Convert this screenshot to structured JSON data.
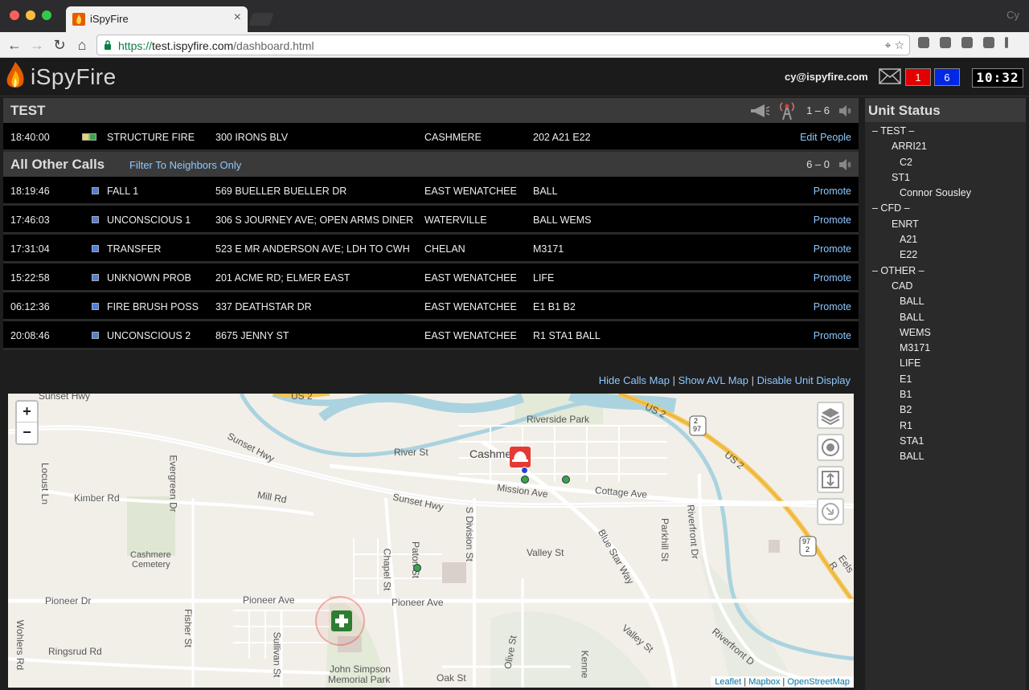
{
  "browser": {
    "tab_title": "iSpyFire",
    "tab_close": "×",
    "profile_label": "Cy",
    "url_scheme": "https://",
    "url_host": "test.ispyfire.com",
    "url_path": "/dashboard.html"
  },
  "header": {
    "app_name": "iSpyFire",
    "user_email": "cy@ispyfire.com",
    "badge_red": "1",
    "badge_blue": "6",
    "clock": "10:32",
    "badge_red_color": "#e30000",
    "badge_blue_color": "#0026e6"
  },
  "test_section": {
    "title": "TEST",
    "count": "1 – 6",
    "call": {
      "time": "18:40:00",
      "type": "STRUCTURE FIRE",
      "address": "300 IRONS BLV",
      "city": "CASHMERE",
      "units": "202 A21 E22",
      "action": "Edit People"
    }
  },
  "other_section": {
    "title": "All Other Calls",
    "filter_label": "Filter To Neighbors Only",
    "count": "6 – 0",
    "calls": [
      {
        "time": "18:19:46",
        "type": "FALL 1",
        "address": "569 BUELLER BUELLER DR",
        "city": "EAST WENATCHEE",
        "units": "BALL",
        "action": "Promote"
      },
      {
        "time": "17:46:03",
        "type": "UNCONSCIOUS 1",
        "address": "306 S JOURNEY AVE; OPEN ARMS DINER",
        "city": "WATERVILLE",
        "units": "BALL WEMS",
        "action": "Promote"
      },
      {
        "time": "17:31:04",
        "type": "TRANSFER",
        "address": "523 E MR ANDERSON AVE; LDH TO CWH",
        "city": "CHELAN",
        "units": "M3171",
        "action": "Promote"
      },
      {
        "time": "15:22:58",
        "type": "UNKNOWN PROB",
        "address": "201 ACME RD; ELMER EAST",
        "city": "EAST WENATCHEE",
        "units": "LIFE",
        "action": "Promote"
      },
      {
        "time": "06:12:36",
        "type": "FIRE BRUSH POSS",
        "address": "337 DEATHSTAR DR",
        "city": "EAST WENATCHEE",
        "units": "E1 B1 B2",
        "action": "Promote"
      },
      {
        "time": "20:08:46",
        "type": "UNCONSCIOUS 2",
        "address": "8675 JENNY ST",
        "city": "EAST WENATCHEE",
        "units": "R1 STA1 BALL",
        "action": "Promote"
      }
    ]
  },
  "map_links": {
    "hide_calls_map": "Hide Calls Map",
    "show_avl_map": "Show AVL Map",
    "disable_unit_display": "Disable Unit Display",
    "sep": "|"
  },
  "map": {
    "zoom_in": "+",
    "zoom_out": "−",
    "attribution": {
      "leaflet": "Leaflet",
      "mapbox": "Mapbox",
      "osm": "OpenStreetMap",
      "sep": "|"
    },
    "labels": {
      "sunset_hwy_top": "Sunset Hwy",
      "us2_a": "US 2",
      "us2_b": "US 2",
      "us2_c": "US 2",
      "us2_shield": "2",
      "us2_shield_b": "97",
      "riverside_park": "Riverside Park",
      "river_st": "River St",
      "cashmere": "Cashmere",
      "sunset_hwy_1": "Sunset Hwy",
      "sunset_hwy_2": "Sunset Hwy",
      "mill_rd": "Mill Rd",
      "mission_ave": "Mission Ave",
      "cottage_ave": "Cottage Ave",
      "kimber_rd": "Kimber Rd",
      "locust_ln": "Locust Ln",
      "evergreen_dr": "Evergreen Dr",
      "cashmere_cemetery_1": "Cashmere",
      "cashmere_cemetery_2": "Cemetery",
      "s_division_st": "S Division St",
      "blue_star_way": "Blue Star Way",
      "parkhill_st": "Parkhill St",
      "riverfront_dr": "Riverfront Dr",
      "valley_st": "Valley St",
      "valley_st_2": "Valley St",
      "chapel_st": "Chapel St",
      "paton_st": "Paton St",
      "pioneer_dr": "Pioneer Dr",
      "pioneer_ave_1": "Pioneer Ave",
      "pioneer_ave_2": "Pioneer Ave",
      "fisher_st": "Fisher St",
      "wohlers_rd": "Wohlers Rd",
      "ringsrud_rd": "Ringsrud Rd",
      "sullivan_st": "Sullivan St",
      "john_simpson_1": "John Simpson",
      "john_simpson_2": "Memorial Park",
      "oak_st": "Oak St",
      "olive_st": "Olive St",
      "kenney": "Kenne",
      "eels_rd": "Eels R",
      "riverfront_dr_2": "Riverfront D",
      "us97_shield": "97",
      "us97_shield_b": "2"
    }
  },
  "unit_status": {
    "title": "Unit Status",
    "items": [
      {
        "level": 0,
        "label": "– TEST –"
      },
      {
        "level": 1,
        "label": "ARRI21"
      },
      {
        "level": 2,
        "label": "C2"
      },
      {
        "level": 1,
        "label": "ST1"
      },
      {
        "level": 2,
        "label": "Connor Sousley"
      },
      {
        "level": 0,
        "label": "– CFD –"
      },
      {
        "level": 1,
        "label": "ENRT"
      },
      {
        "level": 2,
        "label": "A21"
      },
      {
        "level": 2,
        "label": "E22"
      },
      {
        "level": 0,
        "label": "– OTHER –"
      },
      {
        "level": 1,
        "label": "CAD"
      },
      {
        "level": 2,
        "label": "BALL"
      },
      {
        "level": 2,
        "label": "BALL"
      },
      {
        "level": 2,
        "label": "WEMS"
      },
      {
        "level": 2,
        "label": "M3171"
      },
      {
        "level": 2,
        "label": "LIFE"
      },
      {
        "level": 2,
        "label": "E1"
      },
      {
        "level": 2,
        "label": "B1"
      },
      {
        "level": 2,
        "label": "B2"
      },
      {
        "level": 2,
        "label": "R1"
      },
      {
        "level": 2,
        "label": "STA1"
      },
      {
        "level": 2,
        "label": "BALL"
      }
    ]
  },
  "colors": {
    "link": "#8ec8ff",
    "call_marker": "#e53935",
    "hospital_marker": "#2e7d32",
    "water": "#aad3df",
    "highway": "#f6c44f"
  }
}
